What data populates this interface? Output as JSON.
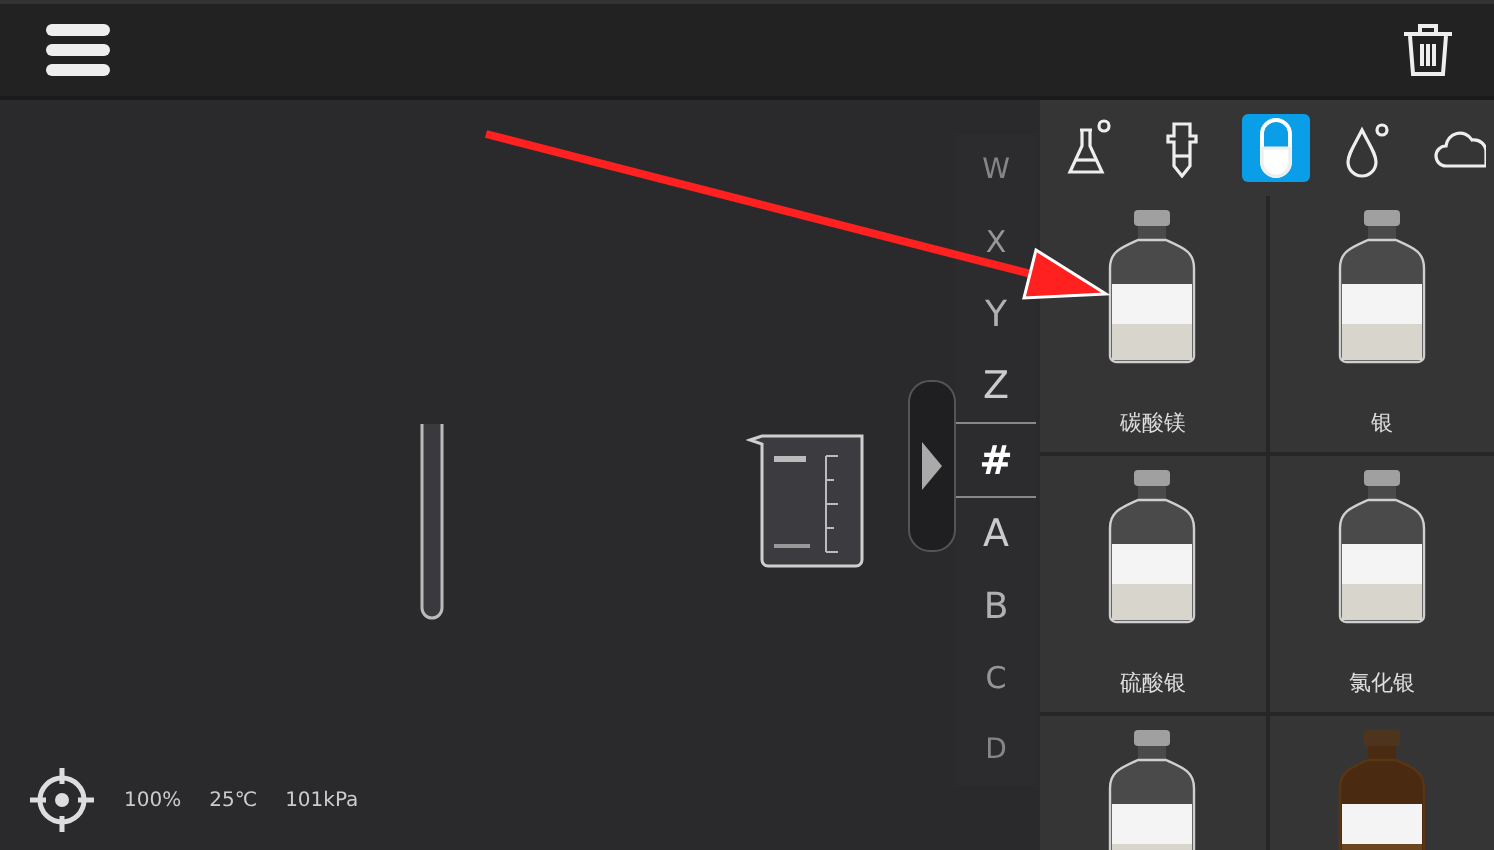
{
  "index_letters": [
    {
      "letter": "W",
      "selected": false
    },
    {
      "letter": "X",
      "selected": false
    },
    {
      "letter": "Y",
      "selected": false
    },
    {
      "letter": "Z",
      "selected": false
    },
    {
      "letter": "#",
      "selected": true
    },
    {
      "letter": "A",
      "selected": false
    },
    {
      "letter": "B",
      "selected": false
    },
    {
      "letter": "C",
      "selected": false
    },
    {
      "letter": "D",
      "selected": false
    }
  ],
  "category_tabs": [
    {
      "kind": "flask",
      "selected": false
    },
    {
      "kind": "dropper",
      "selected": false
    },
    {
      "kind": "capsule",
      "selected": true
    },
    {
      "kind": "drop",
      "selected": false
    },
    {
      "kind": "cloud",
      "selected": false
    }
  ],
  "reagents": [
    {
      "name": "碳酸镁",
      "kind": "clear"
    },
    {
      "name": "银",
      "kind": "clear"
    },
    {
      "name": "硫酸银",
      "kind": "clear"
    },
    {
      "name": "氯化银",
      "kind": "clear"
    },
    {
      "kind": "clear"
    },
    {
      "kind": "brown"
    }
  ],
  "status_bar": {
    "readings": [
      "100%",
      "25℃",
      "101kPa"
    ]
  }
}
